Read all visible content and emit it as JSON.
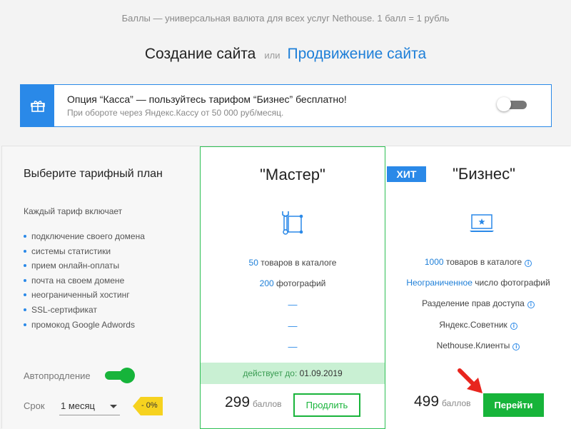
{
  "header": {
    "note": "Баллы — универсальная валюта для всех услуг Nethouse. 1 балл = 1 рубль",
    "tab_active": "Создание сайта",
    "or": "или",
    "tab_other": "Продвижение сайта"
  },
  "promo": {
    "icon": "gift-icon",
    "title": "Опция “Касса” — пользуйтесь тарифом “Бизнес” бесплатно!",
    "subtitle": "При обороте через Яндекс.Кассу от 50 000 руб/месяц.",
    "toggle_on": false
  },
  "sidebar": {
    "title": "Выберите тарифный план",
    "subtitle": "Каждый тариф включает",
    "features": [
      "подключение своего домена",
      "системы статистики",
      "прием онлайн-оплаты",
      "почта на своем домене",
      "неограниченный хостинг",
      "SSL-сертификат",
      "промокод Google Adwords"
    ],
    "autorenew_label": "Автопродление",
    "autorenew_on": true,
    "term_label": "Срок",
    "term_value": "1 месяц",
    "discount": "- 0%"
  },
  "plans": {
    "master": {
      "name": "\"Мастер\"",
      "icon": "tools-icon",
      "f1_value": "50",
      "f1_text": " товаров в каталоге",
      "f2_value": "200",
      "f2_text": " фотографий",
      "dashes": [
        "—",
        "—",
        "—"
      ],
      "valid_label": "действует до: ",
      "valid_date": "01.09.2019",
      "price": "299",
      "price_unit": "баллов",
      "button": "Продлить"
    },
    "business": {
      "badge": "ХИТ",
      "name": "\"Бизнес\"",
      "icon": "laptop-star-icon",
      "f1_value": "1000",
      "f1_text": " товаров в каталоге",
      "f2_value": "Неограниченное",
      "f2_text": " число фотографий",
      "f3": "Разделение прав доступа",
      "f4": "Яндекс.Советник",
      "f5": "Nethouse.Клиенты",
      "info_glyph": "i",
      "price": "499",
      "price_unit": "баллов",
      "button": "Перейти"
    }
  },
  "colors": {
    "accent_blue": "#2a89e8",
    "accent_green": "#19b43b",
    "badge_yellow": "#f6d21f",
    "arrow_red": "#e8251e"
  }
}
